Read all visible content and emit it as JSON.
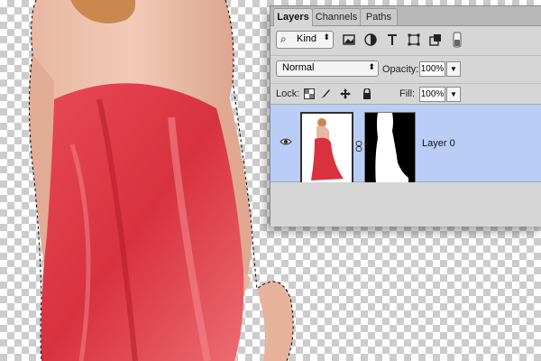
{
  "tabs": [
    {
      "label": "Layers",
      "active": true
    },
    {
      "label": "Channels",
      "active": false
    },
    {
      "label": "Paths",
      "active": false
    }
  ],
  "filter": {
    "kind_label": "Kind",
    "icons": [
      "image-filter-icon",
      "adjustment-filter-icon",
      "type-filter-icon",
      "shape-filter-icon",
      "smart-object-filter-icon",
      "filter-toggle-icon"
    ]
  },
  "blend": {
    "mode": "Normal",
    "opacity_label": "Opacity:",
    "opacity_value": "100%",
    "fill_label": "Fill:",
    "fill_value": "100%"
  },
  "lock": {
    "label": "Lock:",
    "icons": [
      "lock-transparent-pixels-icon",
      "lock-image-pixels-icon",
      "lock-position-icon",
      "lock-all-icon"
    ]
  },
  "layers": [
    {
      "name": "Layer 0",
      "visible": true,
      "selected": true,
      "has_mask": true
    }
  ],
  "colors": {
    "selected_row": "#b9cdf7",
    "panel_bg": "#d6d6d6",
    "dress_red": "#e0434d"
  }
}
